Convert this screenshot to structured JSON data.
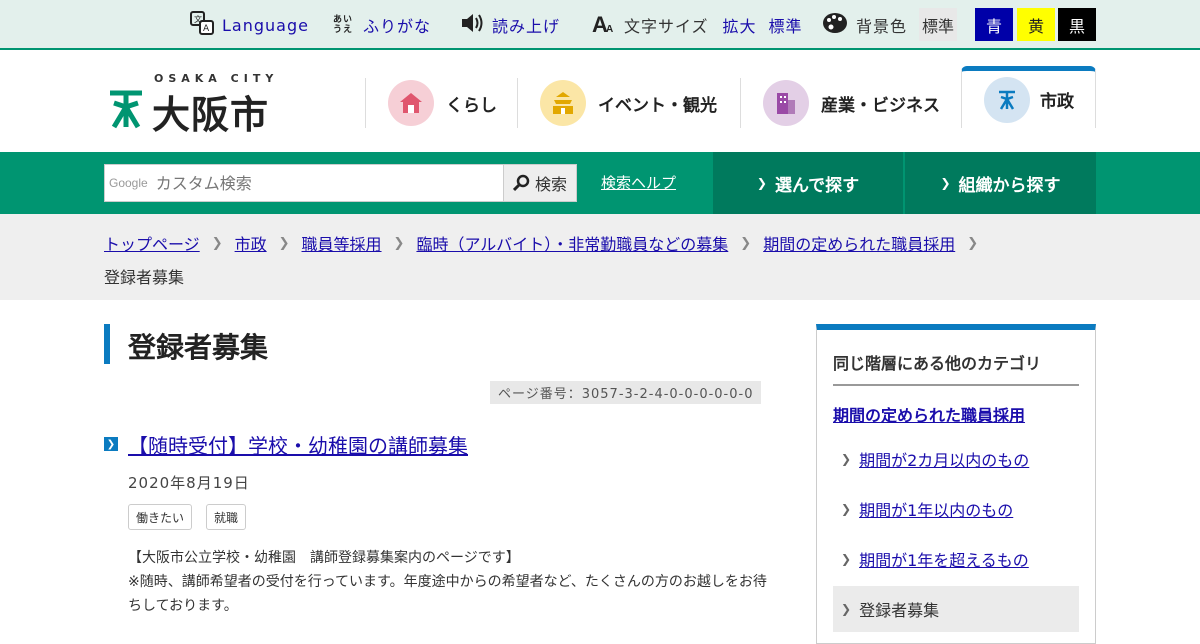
{
  "utility": {
    "language": "Language",
    "furigana": "ふりがな",
    "furigana_icon_text": "あい うえ",
    "read_aloud": "読み上げ",
    "font_size_label": "文字サイズ",
    "font_enlarge": "拡大",
    "font_standard": "標準",
    "bg_color_label": "背景色",
    "bg_options": [
      "標準",
      "青",
      "黄",
      "黒"
    ]
  },
  "colors": {
    "brand_green": "#009571",
    "accent_blue": "#0b7bc0",
    "link": "#1a0dab"
  },
  "header": {
    "logo_sub": "OSAKA CITY",
    "logo_main": "大阪市",
    "nav": [
      "くらし",
      "イベント・観光",
      "産業・ビジネス",
      "市政"
    ]
  },
  "search": {
    "google_label": "Google",
    "placeholder": "カスタム検索",
    "button": "検索",
    "help": "検索ヘルプ",
    "tab_select": "選んで探す",
    "tab_org": "組織から探す"
  },
  "breadcrumb": {
    "items": [
      "トップページ",
      "市政",
      "職員等採用",
      "臨時（アルバイト）・非常勤職員などの募集",
      "期間の定められた職員採用"
    ],
    "current": "登録者募集"
  },
  "main": {
    "title": "登録者募集",
    "page_number": "ページ番号：3057-3-2-4-0-0-0-0-0-0",
    "article": {
      "title": "【随時受付】学校・幼稚園の講師募集",
      "date": "2020年8月19日",
      "tags": [
        "働きたい",
        "就職"
      ],
      "body_line1": "【大阪市公立学校・幼稚園　講師登録募集案内のページです】",
      "body_line2": "※随時、講師希望者の受付を行っています。年度途中からの希望者など、たくさんの方のお越しをお待ちしております。"
    }
  },
  "sidebar": {
    "heading": "同じ階層にある他のカテゴリ",
    "parent": "期間の定められた職員採用",
    "items": [
      "期間が2カ月以内のもの",
      "期間が1年以内のもの",
      "期間が1年を超えるもの"
    ],
    "current": "登録者募集"
  }
}
